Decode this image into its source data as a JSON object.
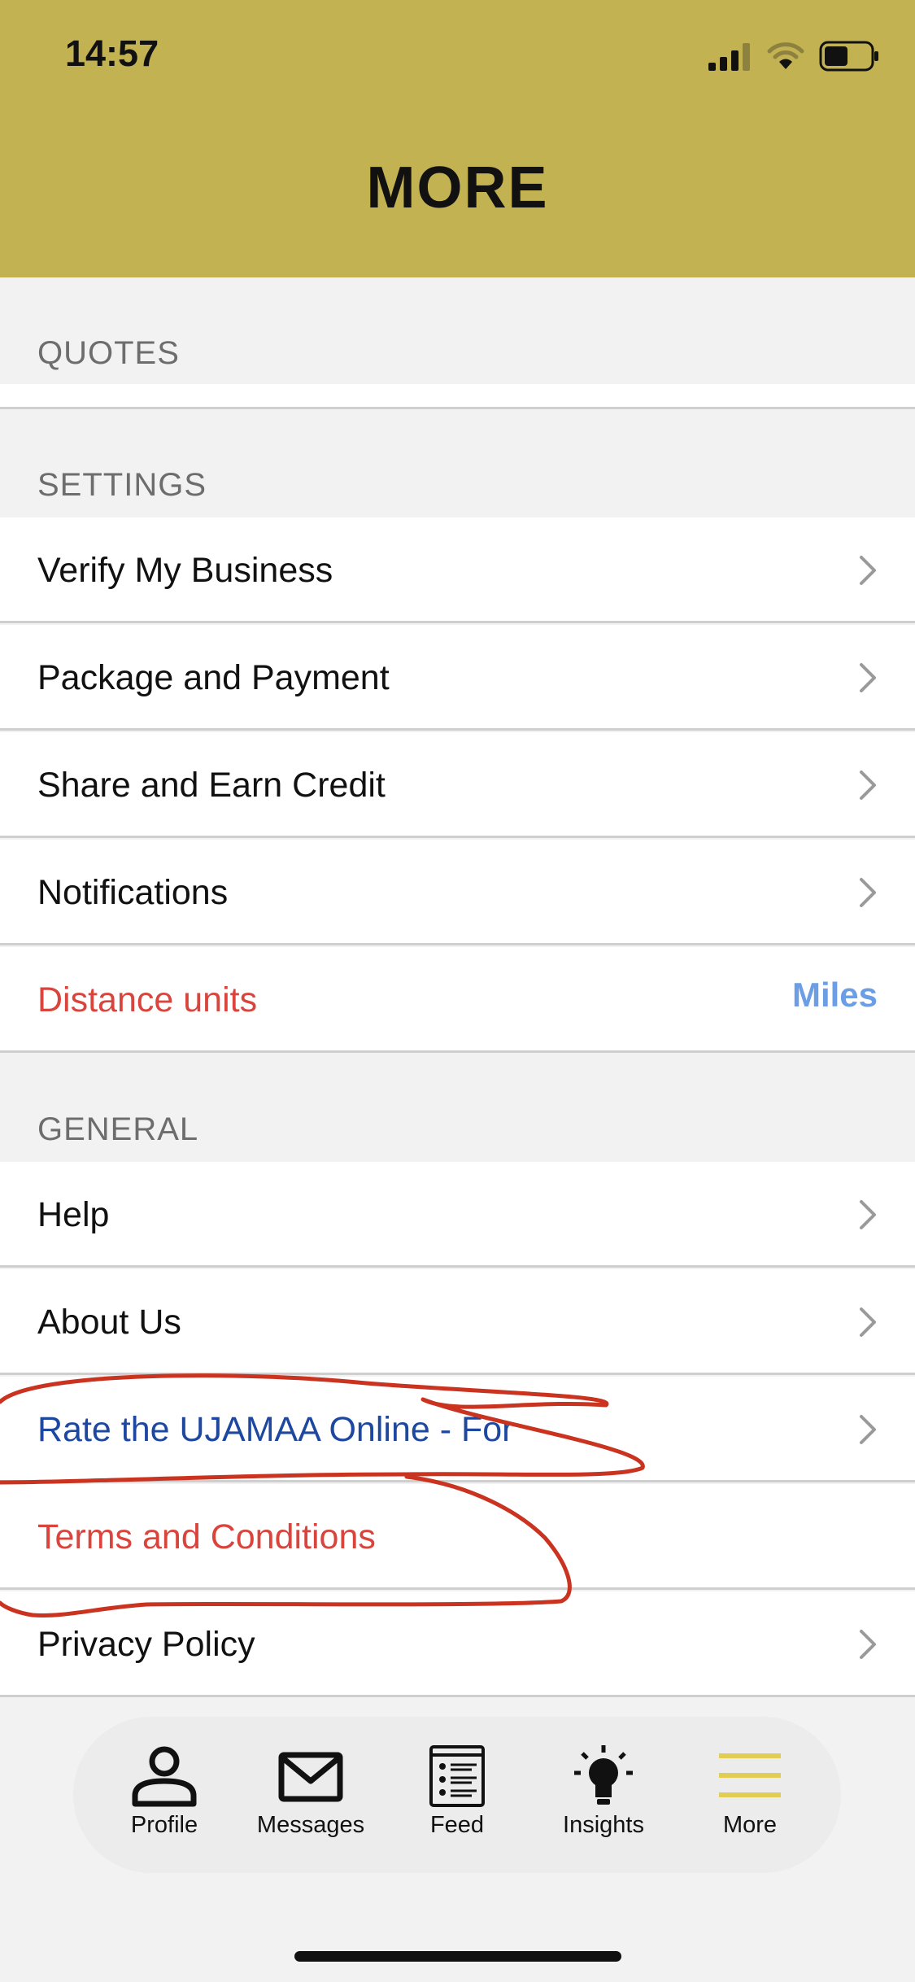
{
  "status_bar": {
    "time": "14:57"
  },
  "header": {
    "title": "MORE"
  },
  "sections": {
    "quotes": {
      "label": "QUOTES"
    },
    "settings": {
      "label": "SETTINGS",
      "items": [
        {
          "label": "Verify My Business"
        },
        {
          "label": "Package and Payment"
        },
        {
          "label": "Share and Earn Credit"
        },
        {
          "label": "Notifications"
        }
      ],
      "distance": {
        "label": "Distance units",
        "value": "Miles"
      }
    },
    "general": {
      "label": "GENERAL",
      "items": [
        {
          "label": "Help"
        },
        {
          "label": "About Us"
        },
        {
          "label": "Rate the UJAMAA Online - For"
        },
        {
          "label": "Terms and Conditions"
        },
        {
          "label": "Privacy Policy"
        }
      ]
    }
  },
  "tabbar": {
    "tabs": [
      {
        "label": "Profile",
        "icon": "person-icon"
      },
      {
        "label": "Messages",
        "icon": "envelope-icon"
      },
      {
        "label": "Feed",
        "icon": "feed-icon"
      },
      {
        "label": "Insights",
        "icon": "lightbulb-icon"
      },
      {
        "label": "More",
        "icon": "menu-icon"
      }
    ],
    "active_color": "#e2cd54"
  },
  "colors": {
    "header_bg": "#c3b252",
    "accent_red": "#d9443d",
    "link_blue": "#1e48a0",
    "value_blue": "#6c9ee6",
    "annotation_red": "#c9331f"
  }
}
